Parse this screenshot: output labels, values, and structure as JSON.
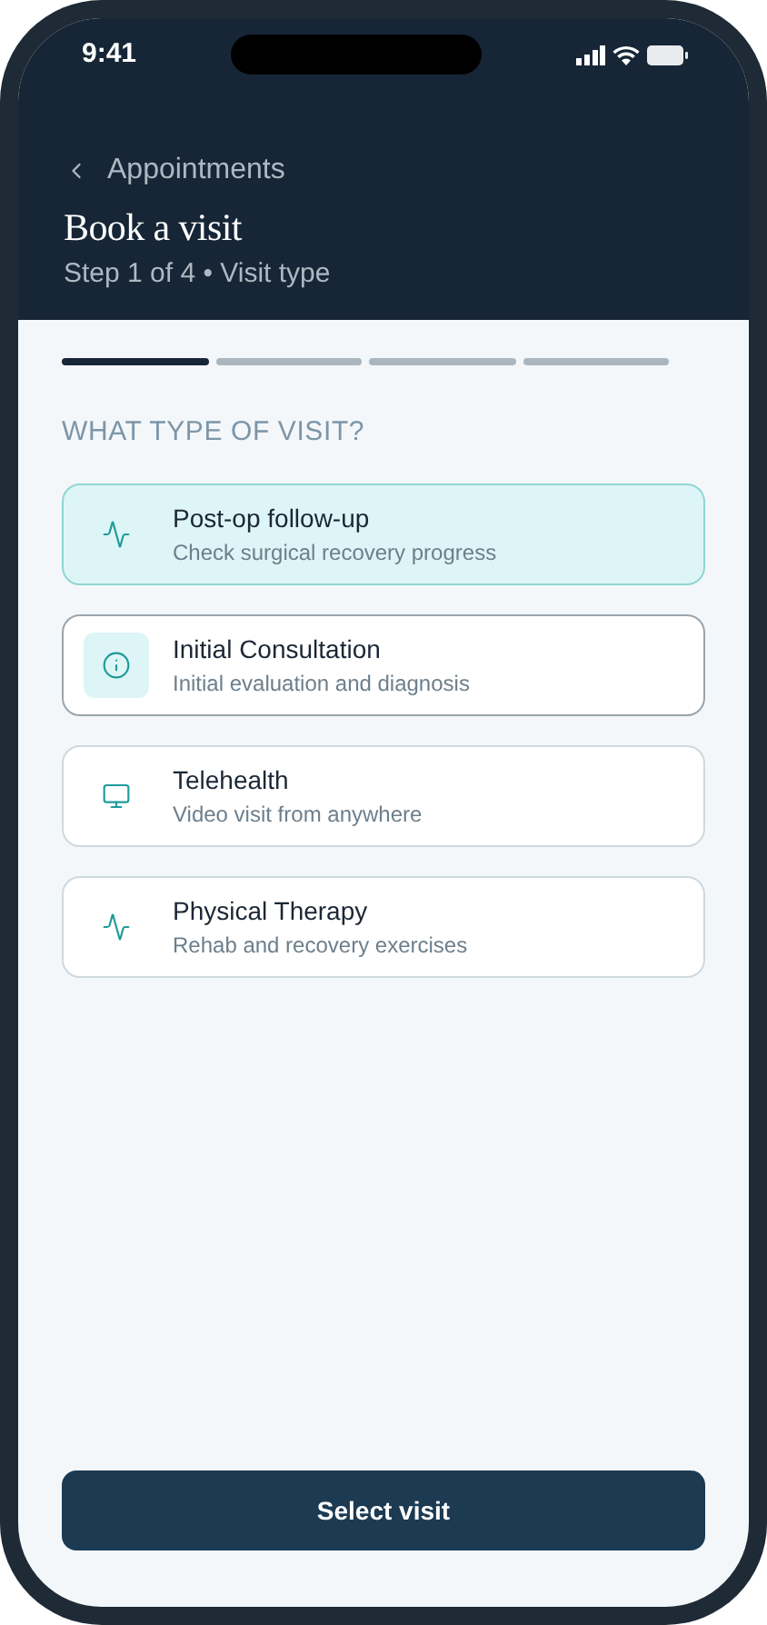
{
  "status_bar": {
    "time": "9:41"
  },
  "header": {
    "back_label": "Appointments",
    "title": "Book a visit",
    "subtitle": "Step 1 of 4 • Visit type"
  },
  "steps": [
    {
      "active": true
    },
    {
      "active": false
    },
    {
      "active": false
    },
    {
      "active": false
    }
  ],
  "section_label": "WHAT TYPE OF VISIT?",
  "visit_types": [
    {
      "kind": "activity",
      "title": "Post-op follow-up",
      "description": "Check surgical recovery progress",
      "selected": true,
      "focused": false
    },
    {
      "kind": "info",
      "title": "Initial Consultation",
      "description": "Initial evaluation and diagnosis",
      "selected": false,
      "focused": true
    },
    {
      "kind": "video",
      "title": "Telehealth",
      "description": "Video visit from anywhere",
      "selected": false,
      "focused": false
    },
    {
      "kind": "activity",
      "title": "Physical Therapy",
      "description": "Rehab and recovery exercises",
      "selected": false,
      "focused": false
    }
  ],
  "primary_button": "Select visit"
}
